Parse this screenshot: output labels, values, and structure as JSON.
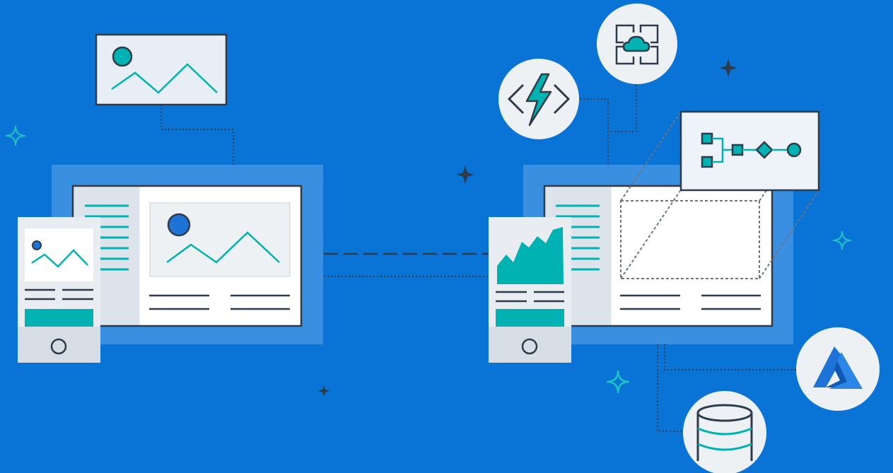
{
  "scene": {
    "background_color": "#0a74d6",
    "panel_color": "#3a8fe0",
    "teal_accent": "#00b2b2",
    "stroke_dark": "#2d3b4a",
    "card_fill": "#eef3f9",
    "screen_fill": "#ffffff",
    "sidebar_fill": "#dde3ea"
  },
  "icons": {
    "image_card": "image-icon",
    "web_app_left": "web-app-icon",
    "mobile_left": "mobile-device-icon",
    "web_app_right": "web-app-icon",
    "mobile_right": "mobile-chart-device-icon",
    "function": "azure-functions-lightning-icon",
    "cloud_service": "cloud-service-icon",
    "logic_flow": "workflow-icon",
    "azure": "azure-logo-icon",
    "database": "database-icon"
  }
}
